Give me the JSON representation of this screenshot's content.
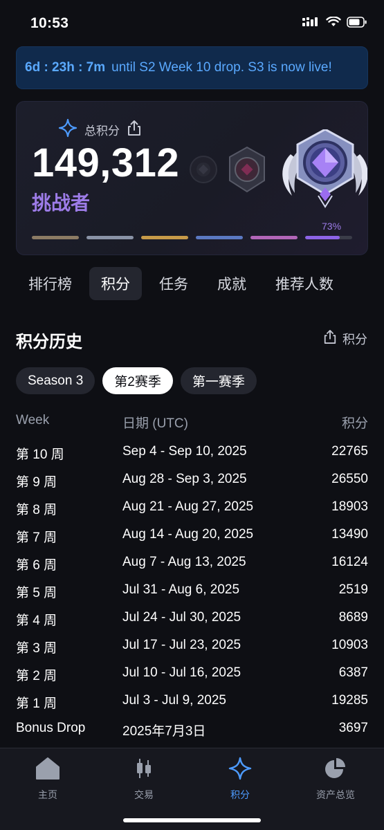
{
  "status": {
    "time": "10:53"
  },
  "banner": {
    "countdown": "6d : 23h : 7m",
    "message": "until S2 Week 10 drop. S3 is now live!"
  },
  "points_card": {
    "title": "总积分",
    "total": "149,312",
    "rank": "挑战者",
    "progress_percent_label": "73%",
    "progress_value": 0.73,
    "tier_colors": [
      "#8c7b64",
      "#8a93a6",
      "#c79a48",
      "#5b79c2",
      "#b266b8",
      "#8d64e6"
    ]
  },
  "tabs": [
    "排行榜",
    "积分",
    "任务",
    "成就",
    "推荐人数"
  ],
  "history": {
    "title": "积分历史",
    "share_label": "积分",
    "seasons": [
      "Season 3",
      "第2赛季",
      "第一赛季"
    ],
    "headers": {
      "week": "Week",
      "date": "日期 (UTC)",
      "points": "积分"
    },
    "rows": [
      {
        "week": "第 10 周",
        "date": "Sep 4 - Sep 10, 2025",
        "points": "22765"
      },
      {
        "week": "第 9 周",
        "date": "Aug 28 - Sep 3, 2025",
        "points": "26550"
      },
      {
        "week": "第 8 周",
        "date": "Aug 21 - Aug 27, 2025",
        "points": "18903"
      },
      {
        "week": "第 7 周",
        "date": "Aug 14 - Aug 20, 2025",
        "points": "13490"
      },
      {
        "week": "第 6 周",
        "date": "Aug 7 - Aug 13, 2025",
        "points": "16124"
      },
      {
        "week": "第 5 周",
        "date": "Jul 31 - Aug 6, 2025",
        "points": "2519"
      },
      {
        "week": "第 4 周",
        "date": "Jul 24 - Jul 30, 2025",
        "points": "8689"
      },
      {
        "week": "第 3 周",
        "date": "Jul 17 - Jul 23, 2025",
        "points": "10903"
      },
      {
        "week": "第 2 周",
        "date": "Jul 10 - Jul 16, 2025",
        "points": "6387"
      },
      {
        "week": "第 1 周",
        "date": "Jul 3 - Jul 9, 2025",
        "points": "19285"
      },
      {
        "week": "Bonus Drop",
        "date": "2025年7月3日",
        "points": "3697"
      }
    ]
  },
  "bottom_nav": [
    {
      "label": "主页",
      "icon": "home-icon"
    },
    {
      "label": "交易",
      "icon": "candlestick-icon"
    },
    {
      "label": "积分",
      "icon": "sparkle-icon"
    },
    {
      "label": "资产总览",
      "icon": "pie-chart-icon"
    }
  ],
  "colors": {
    "accent": "#4d9bff",
    "rank": "#9d7ce8",
    "background": "#0e0f14"
  }
}
